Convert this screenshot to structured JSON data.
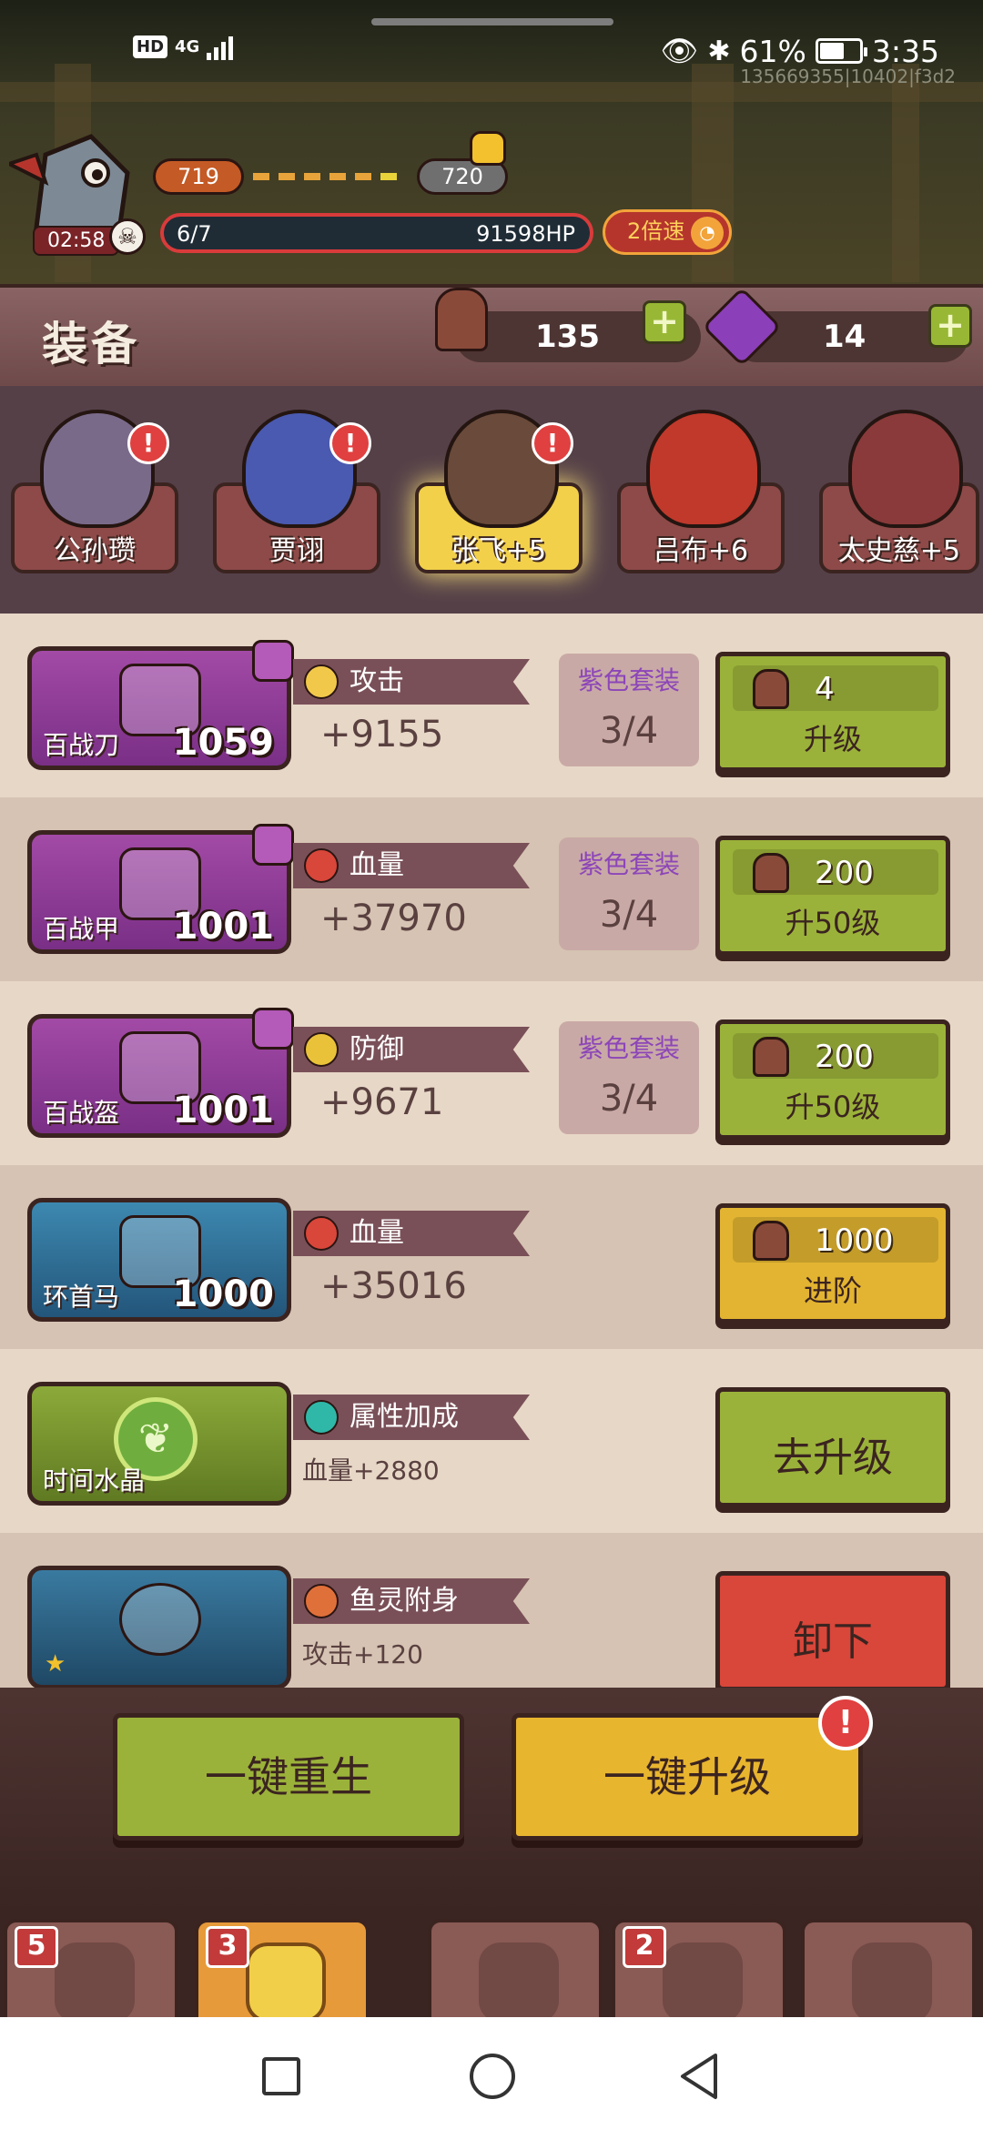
{
  "status": {
    "hd": "HD",
    "network": "4G",
    "battery_pct": "61%",
    "battery_level": 0.61,
    "time": "3:35",
    "device_id": "135669355|10402|f3d2"
  },
  "game": {
    "timer": "02:58",
    "level_current": "719",
    "level_next": "720",
    "wave": "6/7",
    "boss_hp": "91598HP",
    "speed_label": "2倍速"
  },
  "equip": {
    "title": "装备",
    "resource1": "135",
    "resource2": "14"
  },
  "heroes": [
    {
      "name": "公孙瓒",
      "selected": false,
      "alert": true,
      "color": "#7a6a8a"
    },
    {
      "name": "贾诩",
      "selected": false,
      "alert": true,
      "color": "#4a5ab0"
    },
    {
      "name": "张飞+5",
      "selected": true,
      "alert": true,
      "color": "#6a4a3a"
    },
    {
      "name": "吕布+6",
      "selected": false,
      "alert": false,
      "color": "#c0392b"
    },
    {
      "name": "太史慈+5",
      "selected": false,
      "alert": false,
      "color": "#8a3a3a"
    }
  ],
  "items": [
    {
      "name": "百战刀",
      "power": "1059",
      "stat_label": "攻击",
      "stat_value": "+9155",
      "set_label": "紫色套装",
      "set_count": "3/4",
      "cost": "4",
      "button": "升级"
    },
    {
      "name": "百战甲",
      "power": "1001",
      "stat_label": "血量",
      "stat_value": "+37970",
      "set_label": "紫色套装",
      "set_count": "3/4",
      "cost": "200",
      "button": "升50级"
    },
    {
      "name": "百战盔",
      "power": "1001",
      "stat_label": "防御",
      "stat_value": "+9671",
      "set_label": "紫色套装",
      "set_count": "3/4",
      "cost": "200",
      "button": "升50级"
    },
    {
      "name": "环首马",
      "power": "1000",
      "stat_label": "血量",
      "stat_value": "+35016",
      "cost": "1000",
      "button": "进阶"
    },
    {
      "name": "时间水晶",
      "stat_label": "属性加成",
      "stat_value": "血量+2880",
      "button": "去升级"
    },
    {
      "name": "",
      "stat_label": "鱼灵附身",
      "stat_value": "攻击+120",
      "button": "卸下"
    }
  ],
  "actions": {
    "rebirth": "一键重生",
    "upgrade_all": "一键升级",
    "upgrade_alert": "!"
  },
  "tabs": [
    {
      "badge": "5"
    },
    {
      "badge": "3"
    },
    {
      "badge": ""
    },
    {
      "badge": "2"
    },
    {
      "badge": ""
    }
  ],
  "colors": {
    "green_button": "#9bb23a",
    "gold_button": "#e2b431",
    "red_button": "#d9463a",
    "set_purple": "#8c46b8"
  }
}
